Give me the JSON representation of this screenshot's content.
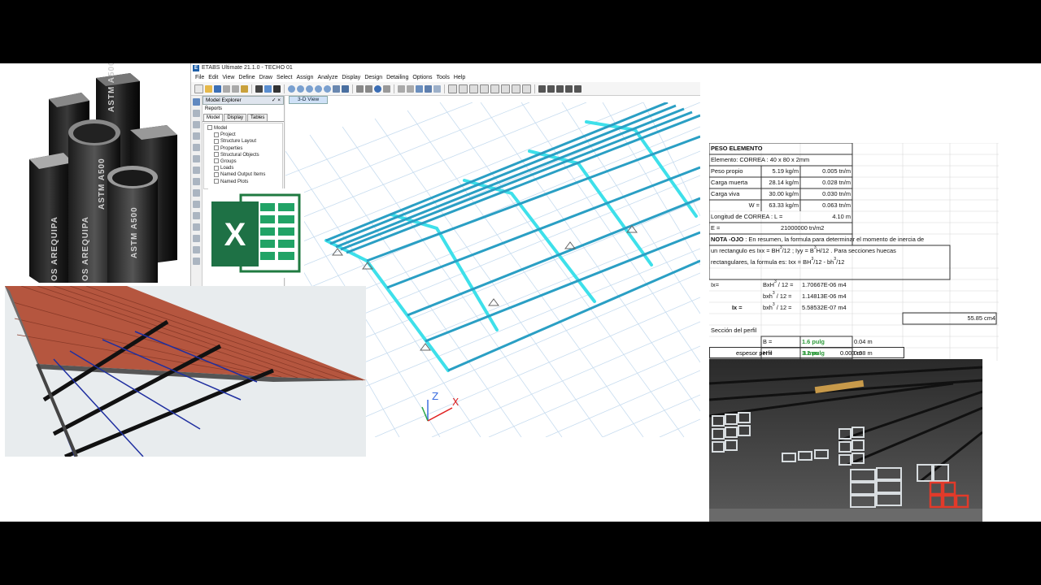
{
  "etabs": {
    "app_letter": "E",
    "title": "ETABS Ultimate 21.1.0 - TECHO 01",
    "menu": [
      "File",
      "Edit",
      "View",
      "Define",
      "Draw",
      "Select",
      "Assign",
      "Analyze",
      "Display",
      "Design",
      "Detailing",
      "Options",
      "Tools",
      "Help"
    ],
    "explorer": {
      "header": "Model Explorer",
      "pin": "✓ ×",
      "reports": "Reports",
      "tabs": [
        "Model",
        "Display",
        "Tables"
      ],
      "tree_root": "Model",
      "tree_items": [
        "Project",
        "Structure Layout",
        "Properties",
        "Structural Objects",
        "Groups",
        "Loads",
        "Named Output Items",
        "Named Plots"
      ]
    },
    "view_tab": "3-D View",
    "axes": {
      "x": "X",
      "z": "Z"
    },
    "colors": {
      "member": "#3ee0ea",
      "member_dark": "#2a9fc4",
      "grid": "#c7dcef"
    }
  },
  "sheet": {
    "title": "PESO ELEMENTO",
    "element": "Elemento: CORREA : 40 x 80 x 2mm",
    "loads": [
      {
        "label": "Peso propio",
        "value": "5.19 kg/m",
        "tn": "0.005 tn/m"
      },
      {
        "label": "Carga muerta",
        "value": "28.14 kg/m",
        "tn": "0.028 tn/m"
      },
      {
        "label": "Carga viva",
        "value": "30.00 kg/m",
        "tn": "0.030 tn/m"
      },
      {
        "label": "W =",
        "value": "63.33 kg/m",
        "tn": "0.063 tn/m"
      }
    ],
    "length_label": "Longitud de  CORREA : L =",
    "length_value": "4.10 m",
    "e_label": "E =",
    "e_value": "21000000 tn/m2",
    "note_bold": "NOTA -OJO",
    "note_line1": " : En resumen, la formula para determinar el momento de inercia de",
    "note_line2a": "un rectangulo es Ixx = BH",
    "note_line2b": "/12 ; Iyy = B",
    "note_line2c": "H/12 . Para secciones huecas",
    "note_line3a": "rectangulares, la formula es: Ixx = BH",
    "note_line3b": "/12 - bh",
    "note_line3c": "/12",
    "sup3": "3",
    "inertia": [
      {
        "label": "Ix=",
        "f1": "BxH",
        "f2": " / 12  =",
        "value": "1.70667E-06 m4"
      },
      {
        "label": "",
        "f1": "bxh",
        "f2": " / 12  =",
        "value": "1.14813E-06 m4"
      },
      {
        "label": "Ix =",
        "f1": "bxh",
        "f2": " / 12  =",
        "value": "5.58532E-07 m4"
      }
    ],
    "result": "55.85 cm4",
    "section_label": "Sección del perfil",
    "profile": [
      {
        "label": "B =",
        "inch": "1.6 pulg",
        "metric": "0.04 m"
      },
      {
        "label": "H =",
        "inch": "3.2 pulg",
        "metric": "0.08 m"
      },
      {
        "label": "espesor perfil",
        "inch": "3 mm",
        "metric": "0.003 m"
      }
    ]
  },
  "photo_tubes": {
    "labels": [
      "ASTM A500",
      "ASTM A500",
      "ASTM A500",
      "OS AREQUIPA",
      "OS AREQUIPA"
    ]
  },
  "excel_logo": {
    "letter": "X"
  }
}
